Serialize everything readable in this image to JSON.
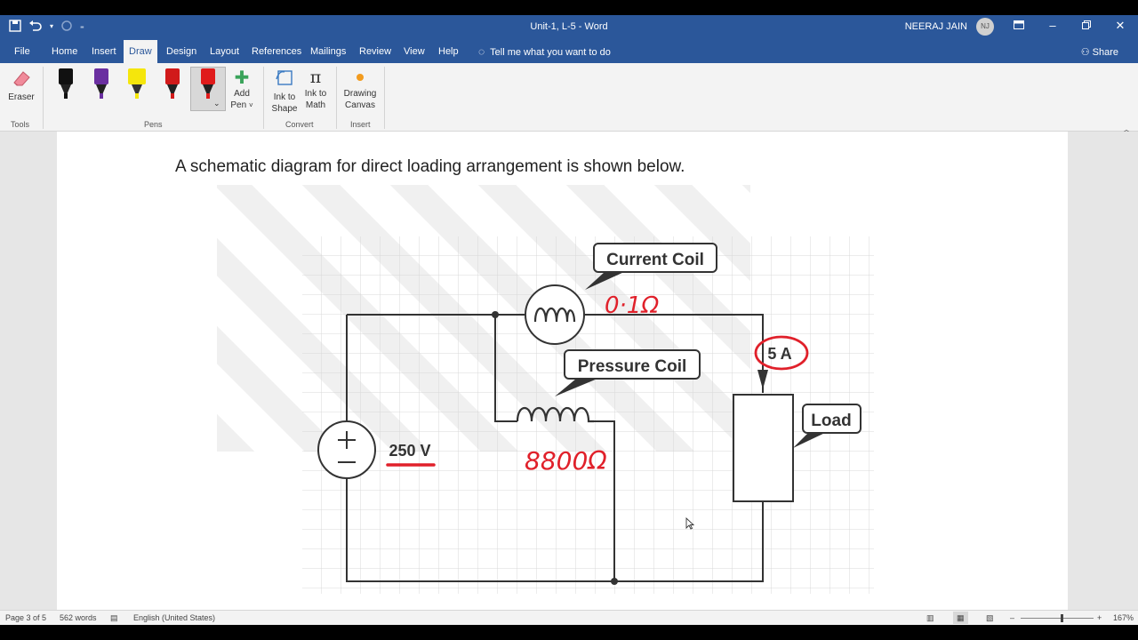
{
  "window": {
    "title": "Unit-1, L-5  -  Word",
    "user_name": "NEERAJ JAIN",
    "user_initials": "NJ"
  },
  "tabs": [
    "File",
    "Home",
    "Insert",
    "Draw",
    "Design",
    "Layout",
    "References",
    "Mailings",
    "Review",
    "View",
    "Help"
  ],
  "active_tab": "Draw",
  "tell_me": "Tell me what you want to do",
  "share": "Share",
  "ribbon": {
    "eraser": "Eraser",
    "add_pen": "Add",
    "add_pen2": "Pen",
    "ink_to_shape_1": "Ink to",
    "ink_to_shape_2": "Shape",
    "ink_to_math_1": "Ink to",
    "ink_to_math_2": "Math",
    "drawing_canvas_1": "Drawing",
    "drawing_canvas_2": "Canvas",
    "groups": {
      "tools": "Tools",
      "pens": "Pens",
      "convert": "Convert",
      "insert": "Insert"
    },
    "pen_colors": [
      "#111111",
      "#6a2fa0",
      "#f5e60c",
      "#d11a1a",
      "#e01b1b"
    ]
  },
  "document": {
    "paragraph": "A schematic diagram for direct loading arrangement is shown below.",
    "diagram": {
      "current_coil": "Current Coil",
      "pressure_coil": "Pressure Coil",
      "load": "Load",
      "voltage": "250 V",
      "current": "5 A",
      "annotation_cc": "0·1Ω",
      "annotation_pc": "8800Ω"
    }
  },
  "status": {
    "page": "Page 3 of 5",
    "words": "562 words",
    "language": "English (United States)",
    "zoom": "167%"
  },
  "colors": {
    "brand": "#2b579a",
    "ink_red": "#e0202a"
  }
}
